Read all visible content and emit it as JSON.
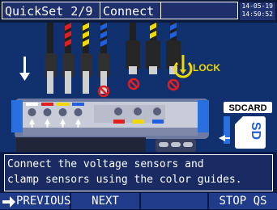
{
  "header": {
    "title": "QuickSet 2/9",
    "step": "Connect",
    "date": "14-05-19",
    "time": "14:50:52"
  },
  "illustration": {
    "lock_label": "LOCK",
    "sd_label": "SDCARD",
    "sd_card_text": "SD",
    "icons": [
      "down-arrow-icon",
      "lock-icon",
      "no-entry-icon",
      "sd-card-icon"
    ]
  },
  "message": {
    "line1": "Connect the voltage sensors and",
    "line2": "clamp sensors using the color guides."
  },
  "function_keys": {
    "f1": "PREVIOUS",
    "f2": "NEXT",
    "f3": "",
    "f4": "STOP QS"
  },
  "colors": {
    "red": "#e02020",
    "yellow": "#f0d800",
    "blue": "#2060e0",
    "background": "#11316e"
  }
}
